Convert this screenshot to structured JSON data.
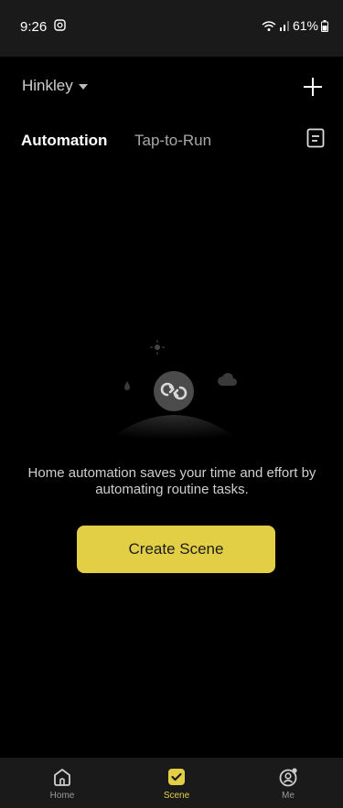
{
  "status_bar": {
    "time": "9:26",
    "battery_percent": "61%"
  },
  "header": {
    "home_name": "Hinkley"
  },
  "tabs": [
    {
      "label": "Automation",
      "active": true
    },
    {
      "label": "Tap-to-Run",
      "active": false
    }
  ],
  "empty_state": {
    "message": "Home automation saves your time and effort by automating routine tasks.",
    "cta_label": "Create Scene"
  },
  "bottom_nav": [
    {
      "label": "Home",
      "icon": "home-icon",
      "active": false
    },
    {
      "label": "Scene",
      "icon": "scene-check-icon",
      "active": true
    },
    {
      "label": "Me",
      "icon": "profile-icon",
      "active": false
    }
  ],
  "colors": {
    "background": "#000000",
    "bar_background": "#1a1a1a",
    "accent": "#e3cf45",
    "text_secondary": "#a8a8a8"
  }
}
